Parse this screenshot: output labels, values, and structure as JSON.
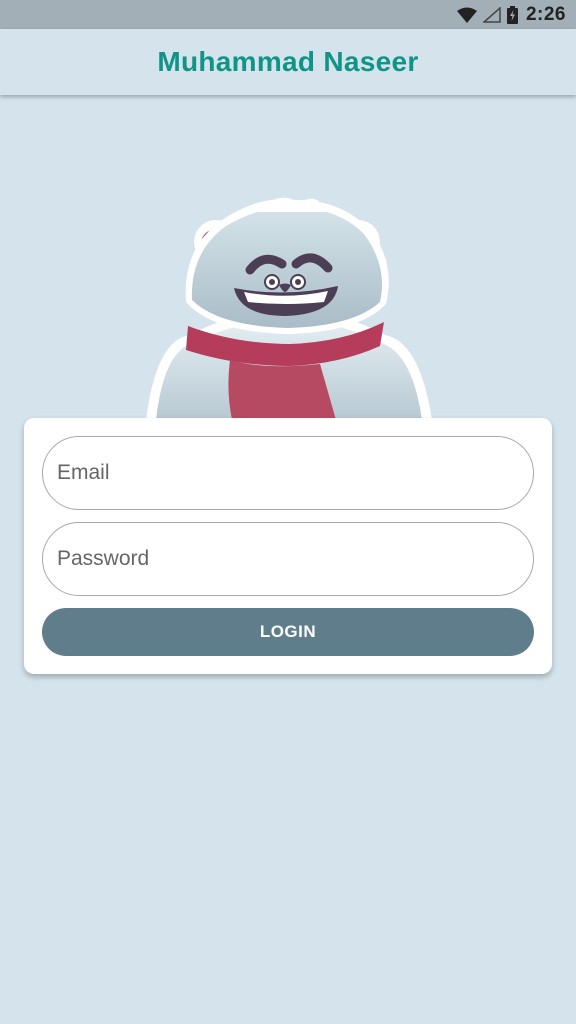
{
  "status_bar": {
    "time": "2:26",
    "icons": [
      "wifi-icon",
      "signal-icon",
      "battery-charging-icon"
    ]
  },
  "app_bar": {
    "title": "Muhammad Naseer"
  },
  "mascot": {
    "icon": "bear-mascot-icon"
  },
  "login_form": {
    "email_placeholder": "Email",
    "password_placeholder": "Password",
    "login_label": "LOGIN"
  },
  "colors": {
    "background": "#d4e3ec",
    "title": "#0f9488",
    "button": "#607d8b"
  }
}
